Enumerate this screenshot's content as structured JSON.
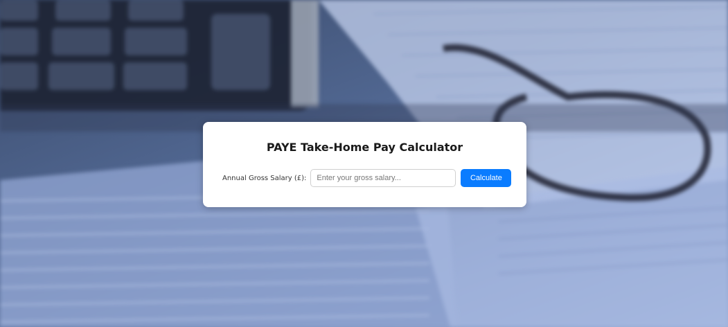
{
  "calculator": {
    "title": "PAYE Take-Home Pay Calculator",
    "salary_label": "Annual Gross Salary (£):",
    "salary_placeholder": "Enter your gross salary...",
    "salary_value": "",
    "calculate_label": "Calculate"
  },
  "colors": {
    "button": "#0a7cff",
    "card": "#ffffff"
  }
}
